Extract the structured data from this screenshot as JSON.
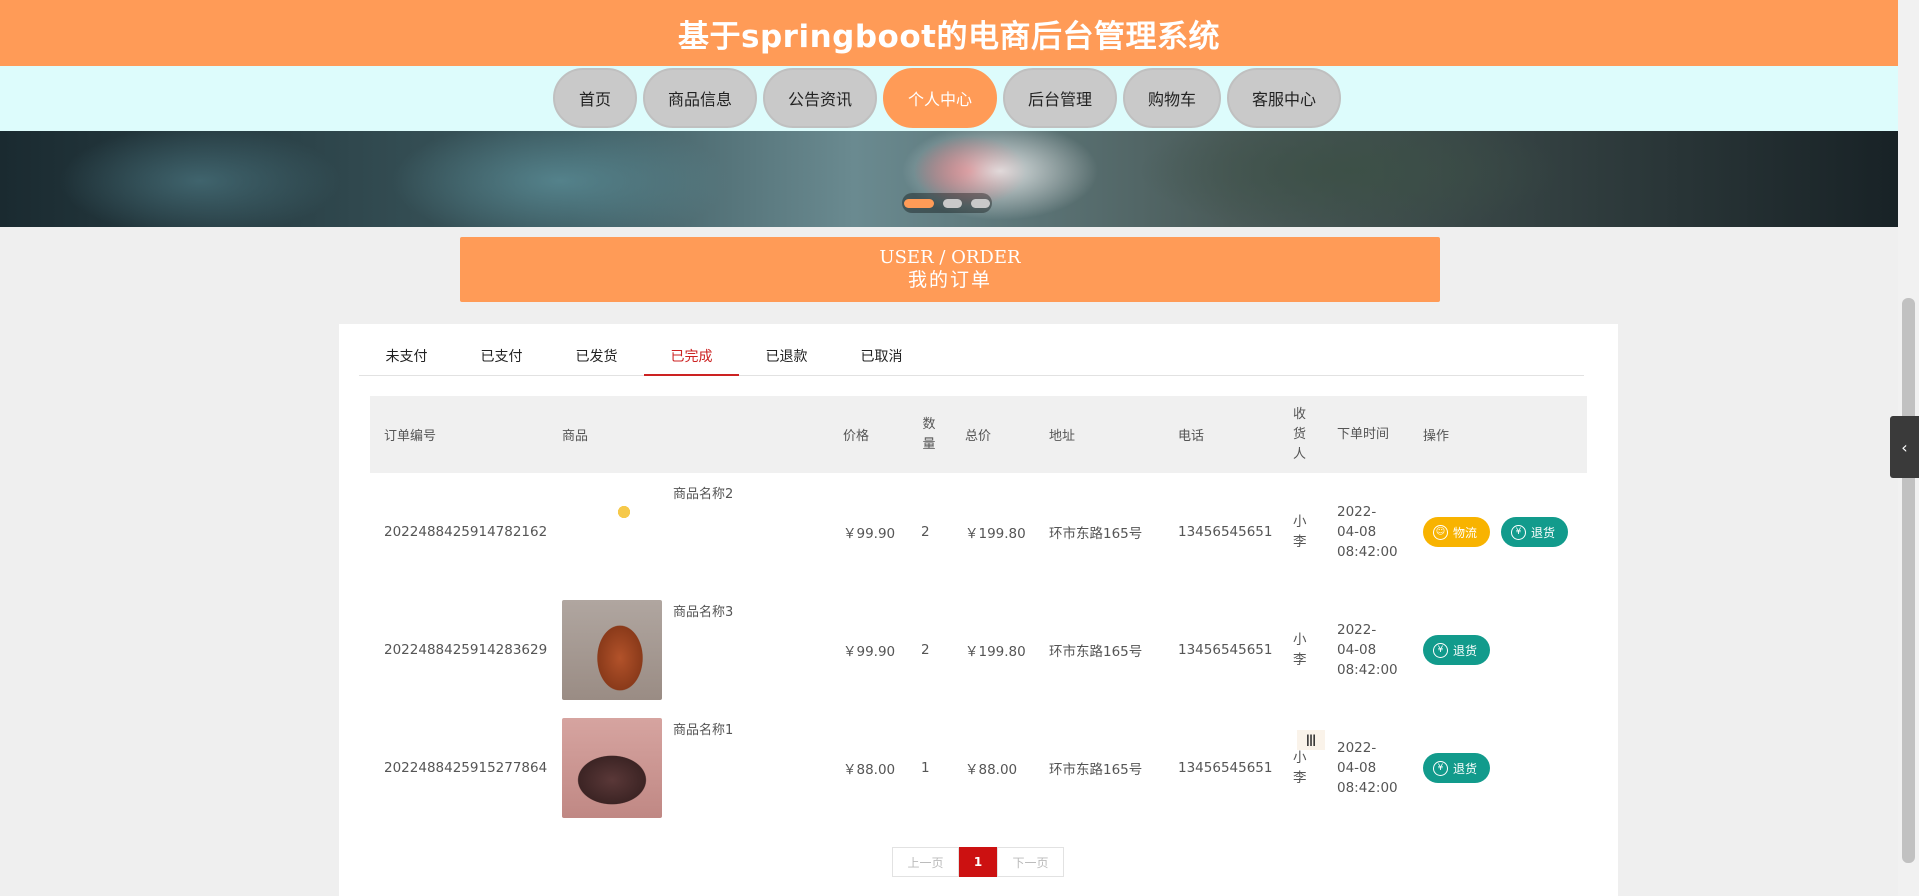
{
  "app": {
    "title": "基于springboot的电商后台管理系统"
  },
  "nav": {
    "items": [
      {
        "label": "首页",
        "active": false
      },
      {
        "label": "商品信息",
        "active": false
      },
      {
        "label": "公告资讯",
        "active": false
      },
      {
        "label": "个人中心",
        "active": true
      },
      {
        "label": "后台管理",
        "active": false
      },
      {
        "label": "购物车",
        "active": false
      },
      {
        "label": "客服中心",
        "active": false
      }
    ]
  },
  "banner": {
    "slide_count": 3,
    "active_slide": 1
  },
  "page_title": {
    "en": "USER / ORDER",
    "cn": "我的订单"
  },
  "tabs": [
    {
      "label": "未支付",
      "active": false
    },
    {
      "label": "已支付",
      "active": false
    },
    {
      "label": "已发货",
      "active": false
    },
    {
      "label": "已完成",
      "active": true
    },
    {
      "label": "已退款",
      "active": false
    },
    {
      "label": "已取消",
      "active": false
    }
  ],
  "table": {
    "headers": {
      "order_no": "订单编号",
      "product": "商品",
      "price": "价格",
      "qty": "数量",
      "total": "总价",
      "address": "地址",
      "phone": "电话",
      "receiver": "收货人",
      "order_time": "下单时间",
      "actions": "操作"
    },
    "rows": [
      {
        "order_no": "2022488425914782162",
        "product_name": "商品名称2",
        "price": "￥99.90",
        "qty": "2",
        "total": "￥199.80",
        "address": "环市东路165号",
        "phone": "13456545651",
        "receiver": "小李",
        "order_time": "2022-04-08 08:42:00",
        "logistics_label": "物流",
        "refund_label": "退货"
      },
      {
        "order_no": "2022488425914283629",
        "product_name": "商品名称3",
        "price": "￥99.90",
        "qty": "2",
        "total": "￥199.80",
        "address": "环市东路165号",
        "phone": "13456545651",
        "receiver": "小李",
        "order_time": "2022-04-08 08:42:00",
        "refund_label": "退货"
      },
      {
        "order_no": "2022488425915277864",
        "product_name": "商品名称1",
        "price": "￥88.00",
        "qty": "1",
        "total": "￥88.00",
        "address": "环市东路165号",
        "phone": "13456545651",
        "receiver": "小李",
        "order_time": "2022-04-08 08:42:00",
        "refund_label": "退货"
      }
    ]
  },
  "pagination": {
    "prev": "上一页",
    "current": "1",
    "next": "下一页"
  },
  "icons": {
    "logistics": "user-icon",
    "refund": "yen-icon",
    "side_handle": "chevron-left-icon"
  },
  "colors": {
    "accent": "#ff9b57",
    "nav_bg": "#ddfcfc",
    "active_tab": "#cc2222",
    "btn_logistics": "#f8b300",
    "btn_refund": "#129b8c"
  }
}
